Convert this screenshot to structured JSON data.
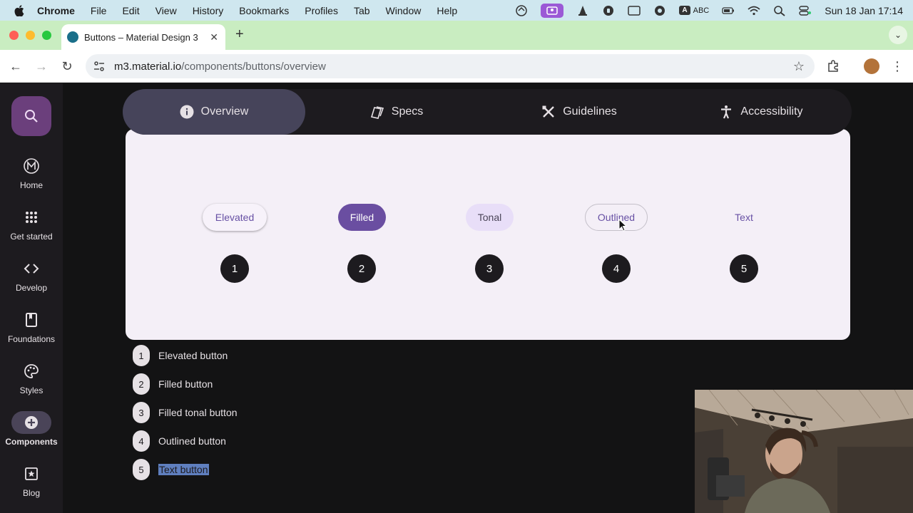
{
  "menubar": {
    "app": "Chrome",
    "items": [
      "File",
      "Edit",
      "View",
      "History",
      "Bookmarks",
      "Profiles",
      "Tab",
      "Window",
      "Help"
    ],
    "input_source_badge": "A",
    "input_source": "ABC",
    "clock": "Sun 18 Jan  17:14"
  },
  "browser": {
    "tab_title": "Buttons – Material Design 3",
    "tab_close": "✕",
    "new_tab": "+",
    "url_host": "m3.material.io",
    "url_path": "/components/buttons/overview"
  },
  "rail": {
    "items": [
      {
        "label": "Home"
      },
      {
        "label": "Get started"
      },
      {
        "label": "Develop"
      },
      {
        "label": "Foundations"
      },
      {
        "label": "Styles"
      },
      {
        "label": "Components"
      },
      {
        "label": "Blog"
      }
    ]
  },
  "content_tabs": [
    {
      "label": "Overview"
    },
    {
      "label": "Specs"
    },
    {
      "label": "Guidelines"
    },
    {
      "label": "Accessibility"
    }
  ],
  "demo": {
    "buttons": [
      {
        "label": "Elevated",
        "number": "1"
      },
      {
        "label": "Filled",
        "number": "2"
      },
      {
        "label": "Tonal",
        "number": "3"
      },
      {
        "label": "Outlined",
        "number": "4"
      },
      {
        "label": "Text",
        "number": "5"
      }
    ]
  },
  "legend": [
    {
      "number": "1",
      "text": "Elevated button"
    },
    {
      "number": "2",
      "text": "Filled button"
    },
    {
      "number": "3",
      "text": "Filled tonal button"
    },
    {
      "number": "4",
      "text": "Outlined button"
    },
    {
      "number": "5",
      "text": "Text button"
    }
  ],
  "colors": {
    "primary": "#6750a4",
    "filled_button": "#6a4ea1",
    "tonal_button": "#e8def8",
    "surface": "#f4eff7",
    "background": "#131314",
    "selection": "#5f7fbf"
  }
}
